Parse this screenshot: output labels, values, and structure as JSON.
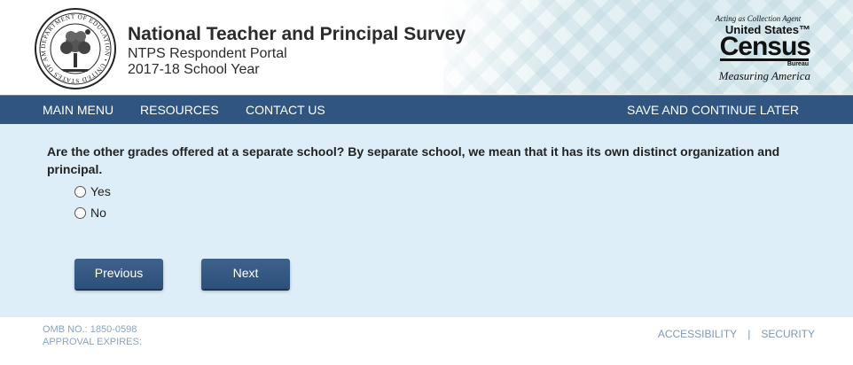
{
  "header": {
    "title": "National Teacher and Principal Survey",
    "subtitle": "NTPS Respondent Portal",
    "year": "2017-18 School Year",
    "seal_text": "DEPARTMENT OF EDUCATION • UNITED STATES OF AMERICA",
    "census": {
      "agent": "Acting as Collection Agent",
      "us": "United States™",
      "word": "Census",
      "bureau": "Bureau",
      "motto": "Measuring America"
    }
  },
  "nav": {
    "main_menu": "MAIN MENU",
    "resources": "RESOURCES",
    "contact": "CONTACT US",
    "save_later": "SAVE AND CONTINUE LATER"
  },
  "question": {
    "text": "Are the other grades offered at a separate school? By separate school, we mean that it has its own distinct organization and principal.",
    "options": [
      {
        "label": "Yes",
        "selected": false
      },
      {
        "label": "No",
        "selected": false
      }
    ]
  },
  "buttons": {
    "previous": "Previous",
    "next": "Next"
  },
  "footer": {
    "omb": "OMB NO.: 1850-0598",
    "approval": "APPROVAL EXPIRES:",
    "accessibility": "ACCESSIBILITY",
    "separator": "|",
    "security": "SECURITY"
  },
  "colors": {
    "nav_bg": "#2f5580",
    "content_bg": "#ddeef8",
    "button_bg": "#2c507a",
    "footer_link": "#7f98b4"
  }
}
